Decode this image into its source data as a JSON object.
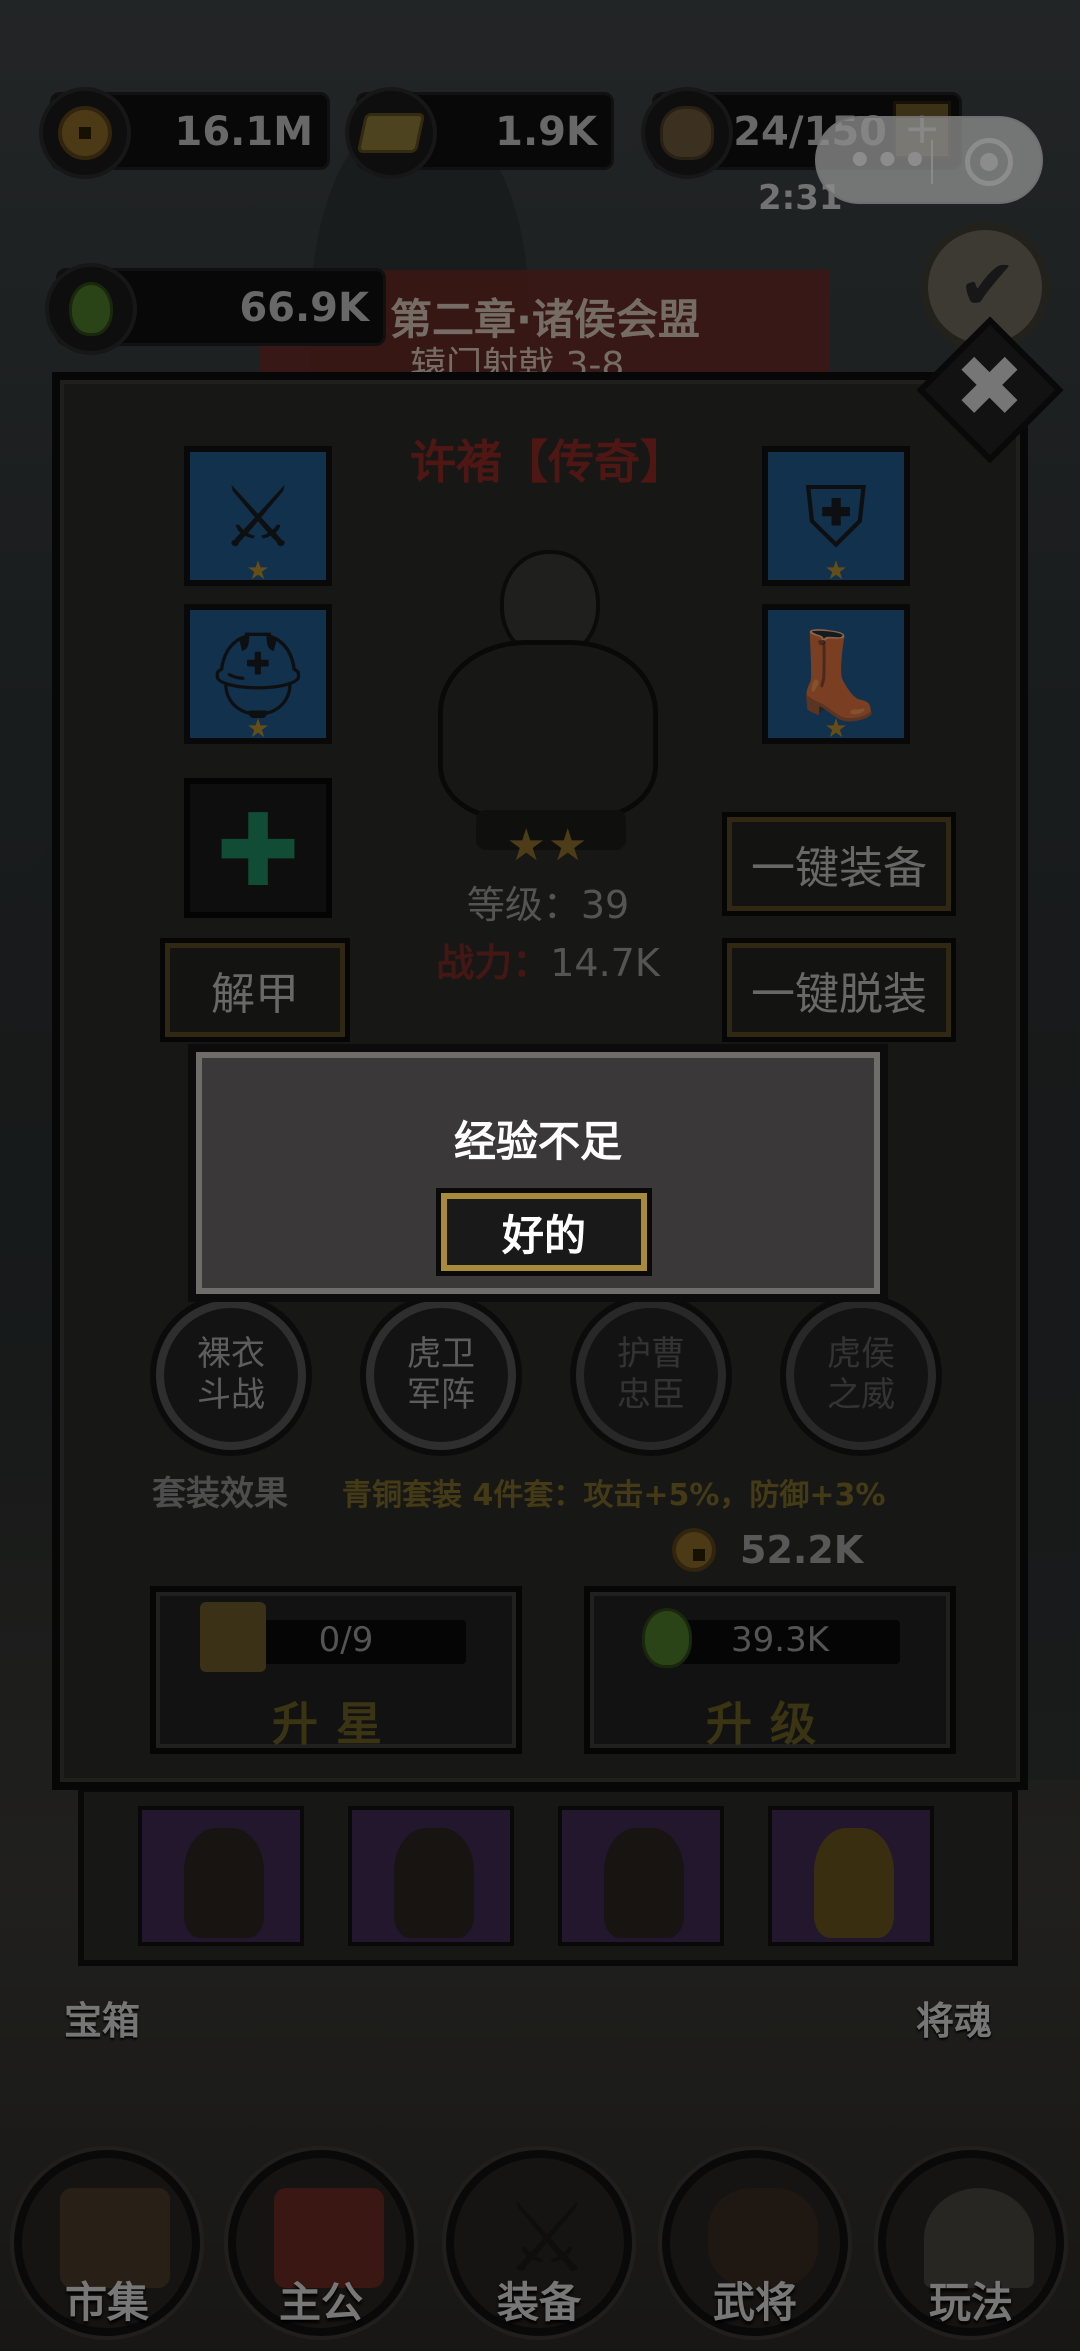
{
  "resources": {
    "coins": "16.1M",
    "gold": "1.9K",
    "stamina": "24/150",
    "stamina_plus": "+",
    "stamina_timer": "2:31",
    "exp_potion": "66.9K"
  },
  "mini_program": {
    "menu_dots": "•••"
  },
  "chapter": {
    "title": "第二章·诸侯会盟",
    "subtitle": "辕门射戟 3-8"
  },
  "hero_panel": {
    "close_glyph": "✖",
    "hero_name": "许褚【传奇】",
    "stars": "★★",
    "level_text": "等级：39",
    "power_label": "战力：",
    "power_value": "14.7K",
    "slot_star": "★",
    "empty_slot_glyph": "✚",
    "btn_unequip": "解甲",
    "btn_equip_all": "一键装备",
    "btn_remove_all": "一键脱装",
    "skills": [
      {
        "line1": "裸衣",
        "line2": "斗战"
      },
      {
        "line1": "虎卫",
        "line2": "军阵"
      },
      {
        "line1": "护曹",
        "line2": "忠臣"
      },
      {
        "line1": "虎侯",
        "line2": "之威"
      }
    ],
    "set_label": "套装效果",
    "set_desc": "青铜套装 4件套：攻击+5%，防御+3%",
    "upgrade_cost": "52.2K",
    "star_up": {
      "progress": "0/9",
      "label": "升星"
    },
    "level_up": {
      "progress": "39.3K",
      "label": "升级"
    }
  },
  "dialog": {
    "message": "经验不足",
    "ok_label": "好的"
  },
  "side": {
    "chest_label": "宝箱",
    "soul_label": "将魂"
  },
  "nav": [
    {
      "label": "市集"
    },
    {
      "label": "主公"
    },
    {
      "label": "装备"
    },
    {
      "label": "武将"
    },
    {
      "label": "玩法"
    }
  ],
  "colors": {
    "hero_name": "#8f2b24",
    "set_desc": "#7d6a27",
    "slot_blue": "#1f5a8d",
    "modal_border_gold": "#a78a3a"
  }
}
